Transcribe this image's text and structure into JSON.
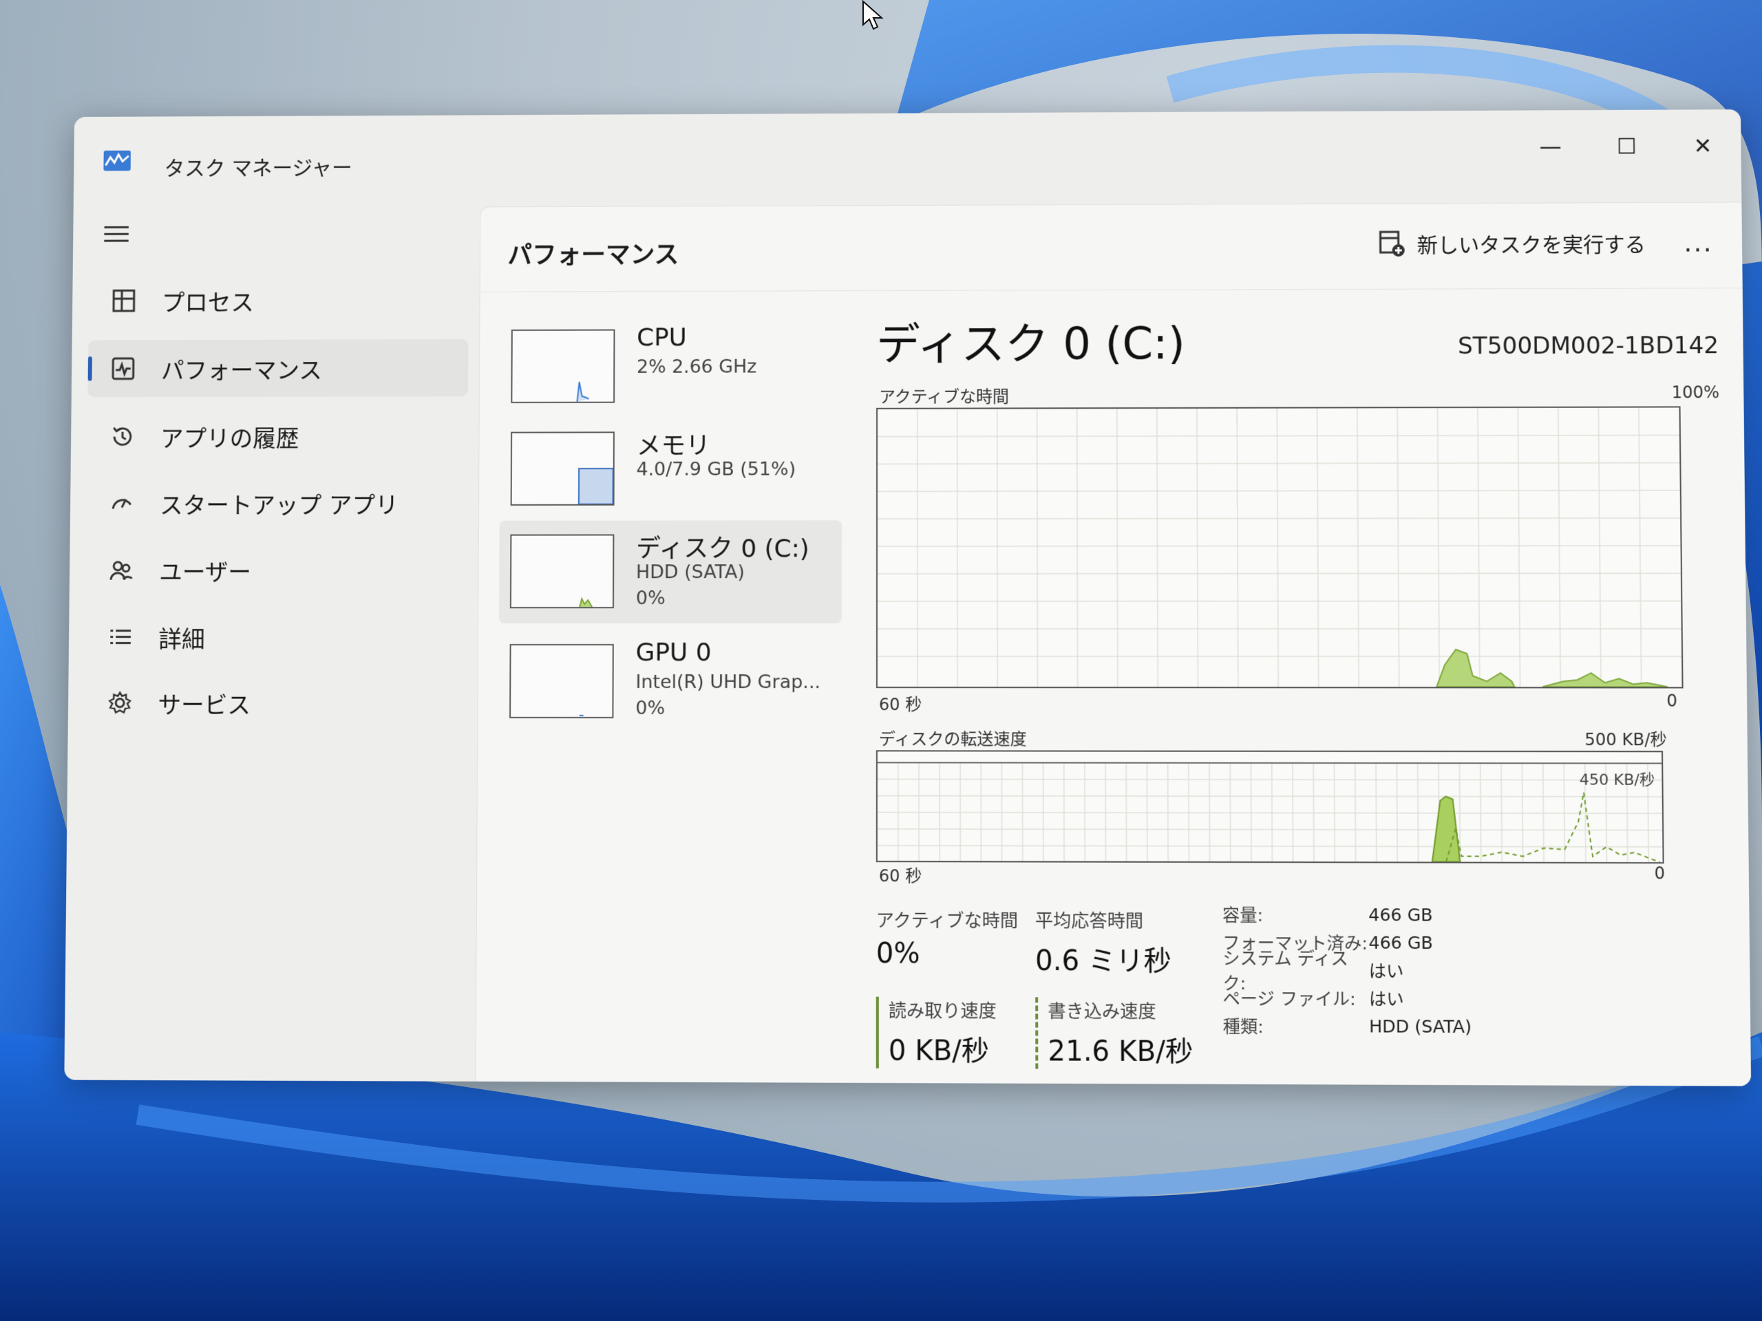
{
  "window": {
    "title": "タスク マネージャー",
    "controls": {
      "minimize": "—",
      "maximize": "☐",
      "close": "✕"
    }
  },
  "sidebar": {
    "items": [
      {
        "label": "プロセス",
        "icon": "processes-icon"
      },
      {
        "label": "パフォーマンス",
        "icon": "performance-icon",
        "active": true
      },
      {
        "label": "アプリの履歴",
        "icon": "history-icon"
      },
      {
        "label": "スタートアップ アプリ",
        "icon": "startup-icon"
      },
      {
        "label": "ユーザー",
        "icon": "users-icon"
      },
      {
        "label": "詳細",
        "icon": "details-icon"
      },
      {
        "label": "サービス",
        "icon": "services-icon"
      }
    ],
    "settings_label": "設定"
  },
  "header": {
    "title": "パフォーマンス",
    "run_task_label": "新しいタスクを実行する",
    "more_label": "..."
  },
  "devices": [
    {
      "name": "CPU",
      "sub1": "2% 2.66 GHz",
      "sub2": ""
    },
    {
      "name": "メモリ",
      "sub1": "4.0/7.9 GB (51%)",
      "sub2": ""
    },
    {
      "name": "ディスク 0 (C:)",
      "sub1": "HDD (SATA)",
      "sub2": "0%",
      "active": true
    },
    {
      "name": "GPU 0",
      "sub1": "Intel(R) UHD Grap...",
      "sub2": "0%"
    }
  ],
  "detail": {
    "title": "ディスク 0 (C:)",
    "model": "ST500DM002-1BD142",
    "active_graph": {
      "label": "アクティブな時間",
      "max": "100%",
      "left_axis": "60 秒",
      "right_axis": "0"
    },
    "transfer_graph": {
      "label": "ディスクの転送速度",
      "max": "500 KB/秒",
      "inner_label": "450 KB/秒",
      "left_axis": "60 秒",
      "right_axis": "0"
    },
    "stats": {
      "active_time_label": "アクティブな時間",
      "active_time_value": "0%",
      "avg_response_label": "平均応答時間",
      "avg_response_value": "0.6 ミリ秒",
      "read_label": "読み取り速度",
      "read_value": "0 KB/秒",
      "write_label": "書き込み速度",
      "write_value": "21.6 KB/秒"
    },
    "properties": [
      {
        "key": "容量:",
        "value": "466 GB"
      },
      {
        "key": "フォーマット済み:",
        "value": "466 GB"
      },
      {
        "key": "システム ディスク:",
        "value": "はい"
      },
      {
        "key": "ページ ファイル:",
        "value": "はい"
      },
      {
        "key": "種類:",
        "value": "HDD (SATA)"
      }
    ]
  },
  "colors": {
    "accent": "#2a5fb8",
    "disk_graph": "#8fbf3a",
    "graph_grid": "#d6dccf"
  }
}
